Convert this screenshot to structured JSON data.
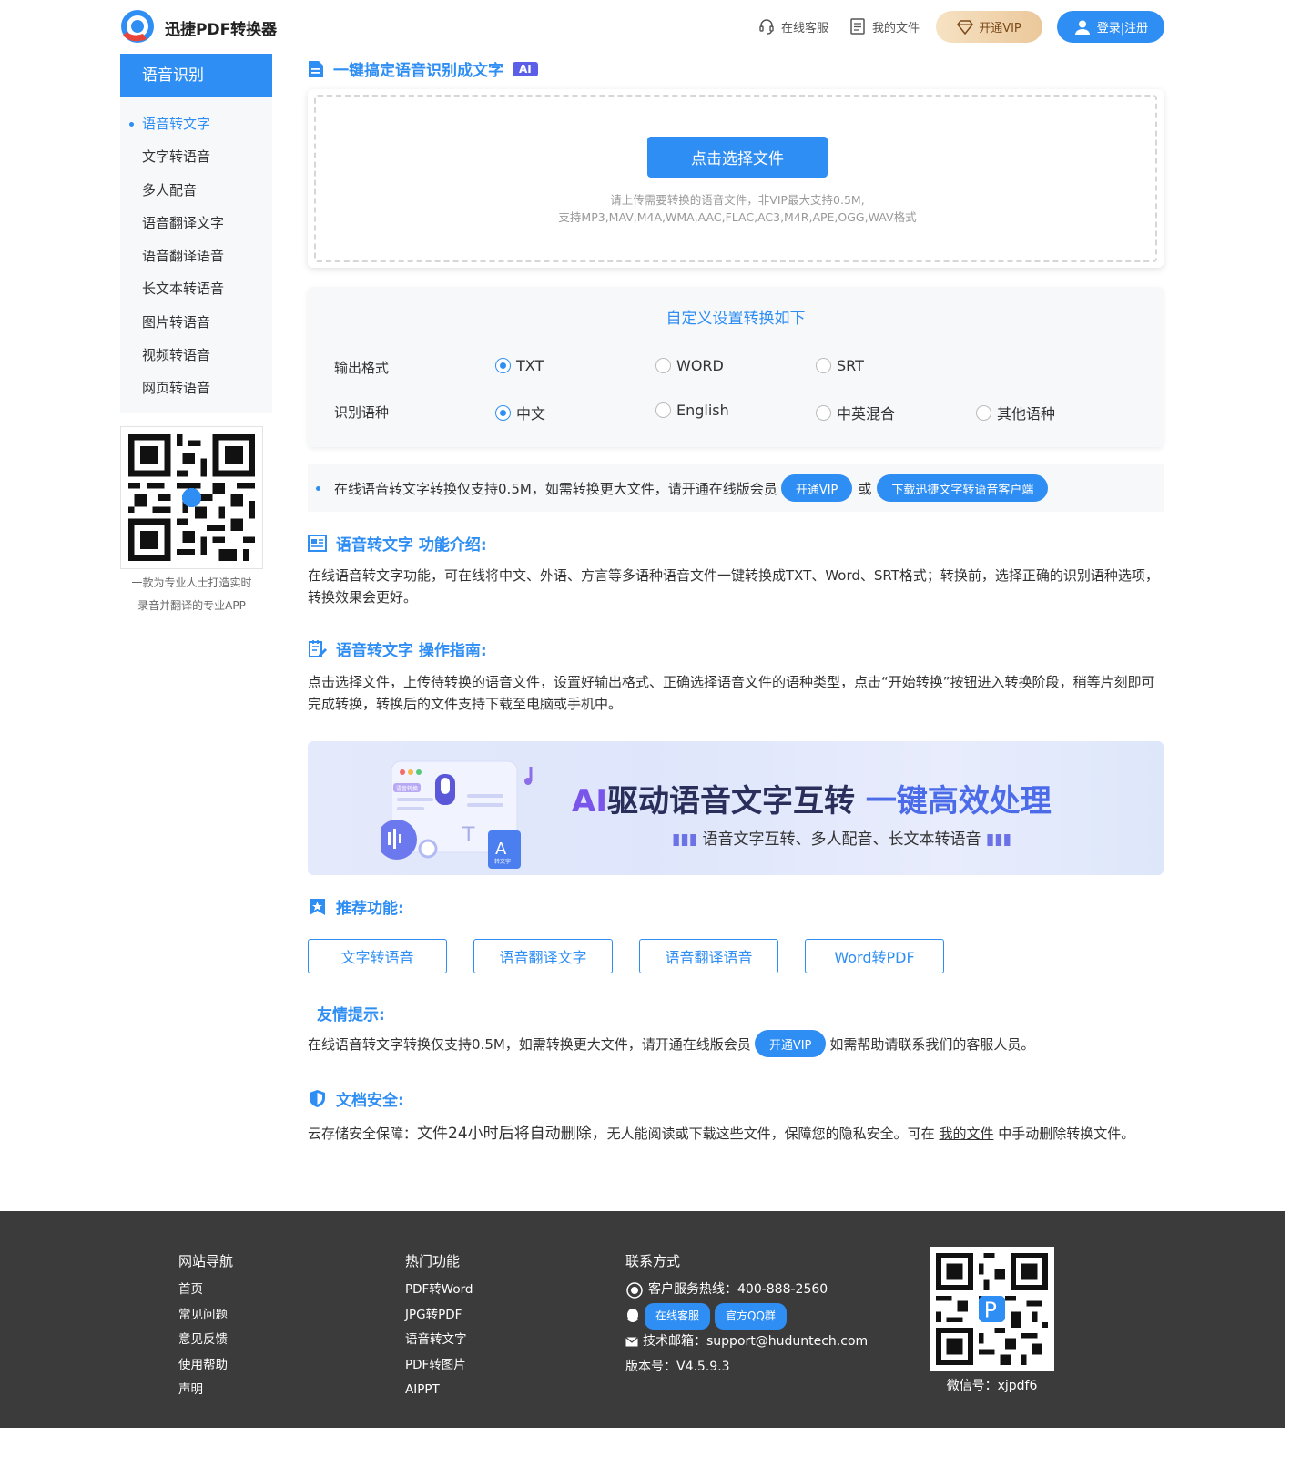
{
  "header": {
    "logo_text": "迅捷PDF转换器",
    "support": "在线客服",
    "my_files": "我的文件",
    "vip": "开通VIP",
    "login": "登录|注册"
  },
  "sidebar": {
    "title": "语音识别",
    "items": [
      "语音转文字",
      "文字转语音",
      "多人配音",
      "语音翻译文字",
      "语音翻译语音",
      "长文本转语音",
      "图片转语音",
      "视频转语音",
      "网页转语音"
    ],
    "qr_caption_1": "一款为专业人士打造实时",
    "qr_caption_2": "录音并翻译的专业APP"
  },
  "main": {
    "title": "一键搞定语音识别成文字",
    "ai_badge": "AI",
    "upload_button": "点击选择文件",
    "upload_hint_1": "请上传需要转换的语音文件，非VIP最大支持0.5M,",
    "upload_hint_2": "支持MP3,MAV,M4A,WMA,AAC,FLAC,AC3,M4R,APE,OGG,WAV格式",
    "settings_title": "自定义设置转换如下",
    "output_label": "输出格式",
    "output_options": [
      "TXT",
      "WORD",
      "SRT"
    ],
    "lang_label": "识别语种",
    "lang_options": [
      "中文",
      "English",
      "中英混合",
      "其他语种"
    ],
    "notice_text": "在线语音转文字转换仅支持0.5M，如需转换更大文件，请开通在线版会员",
    "notice_vip": "开通VIP",
    "notice_or": "或",
    "notice_download": "下载迅捷文字转语音客户端",
    "intro_title": "语音转文字 功能介绍:",
    "intro_text": "在线语音转文字功能，可在线将中文、外语、方言等多语种语音文件一键转换成TXT、Word、SRT格式；转换前，选择正确的识别语种选项，转换效果会更好。",
    "guide_title": "语音转文字 操作指南:",
    "guide_text": "点击选择文件，上传待转换的语音文件，设置好输出格式、正确选择语音文件的语种类型，点击“开始转换”按钮进入转换阶段，稍等片刻即可完成转换，转换后的文件支持下载至电脑或手机中。",
    "banner_ai": "AI",
    "banner_mid": "驱动语音文字互转",
    "banner_hl": "一键高效处理",
    "banner_sub": "语音文字互转、多人配音、长文本转语音",
    "banner_small": "语音转换",
    "banner_small2": "转文字",
    "recommend_title": "推荐功能:",
    "recommend": [
      "文字转语音",
      "语音翻译文字",
      "语音翻译语音",
      "Word转PDF"
    ],
    "tip_title": "友情提示:",
    "tip_text": "在线语音转文字转换仅支持0.5M，如需转换更大文件，请开通在线版会员",
    "tip_vip": "开通VIP",
    "tip_tail": "如需帮助请联系我们的客服人员。",
    "security_title": "文档安全:",
    "security_a": "云存储安全保障：",
    "security_b": "文件24小时后将自动删除，",
    "security_c": "无人能阅读或下载这些文件，保障您的隐私安全。可在",
    "security_link": "我的文件",
    "security_d": "中手动删除转换文件。"
  },
  "footer": {
    "nav_title": "网站导航",
    "nav": [
      "首页",
      "常见问题",
      "意见反馈",
      "使用帮助",
      "声明"
    ],
    "hot_title": "热门功能",
    "hot": [
      "PDF转Word",
      "JPG转PDF",
      "语音转文字",
      "PDF转图片",
      "AIPPT"
    ],
    "contact_title": "联系方式",
    "hotline": "客户服务热线：400-888-2560",
    "online_service": "在线客服",
    "qq_group": "官方QQ群",
    "email": "技术邮箱：support@huduntech.com",
    "version": "版本号：V4.5.9.3",
    "wechat": "微信号：xjpdf6"
  },
  "colors": {
    "accent": "#2f8ef4",
    "footer_bg": "#3b3b3b",
    "vip_gold": "#ebc89b",
    "ai_badge": "#5b5fe8"
  }
}
